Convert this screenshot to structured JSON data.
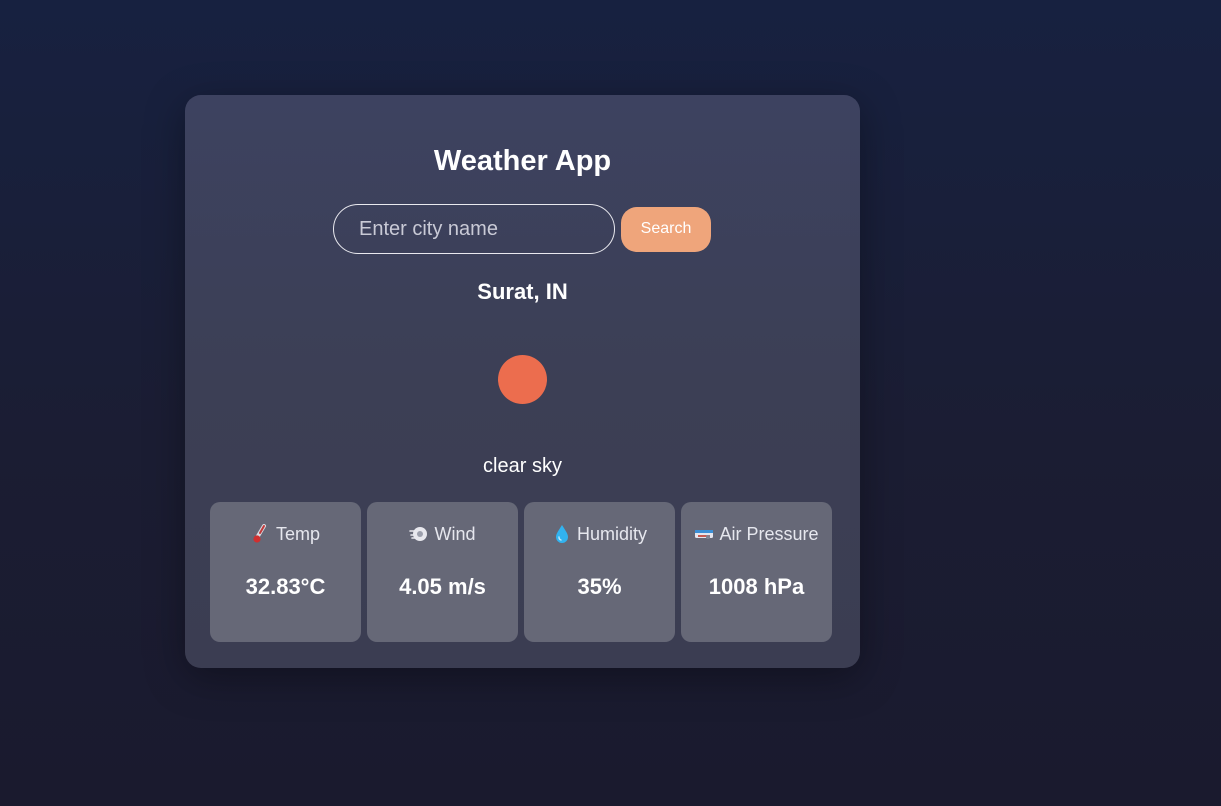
{
  "app": {
    "title": "Weather App"
  },
  "search": {
    "placeholder": "Enter city name",
    "value": "",
    "button_label": "Search"
  },
  "weather": {
    "location": "Surat, IN",
    "icon": "sun-icon",
    "description": "clear sky"
  },
  "stats": [
    {
      "label": "Temp",
      "value": "32.83°C",
      "icon": "thermometer-icon"
    },
    {
      "label": "Wind",
      "value": "4.05 m/s",
      "icon": "wind-icon"
    },
    {
      "label": "Humidity",
      "value": "35%",
      "icon": "droplet-icon"
    },
    {
      "label": "Air Pressure",
      "value": "1008 hPa",
      "icon": "gauge-icon"
    }
  ],
  "colors": {
    "accent": "#efa57b",
    "sun": "#ec6d4e",
    "card_bg": "#3c3f55",
    "stat_bg": "#666877"
  }
}
